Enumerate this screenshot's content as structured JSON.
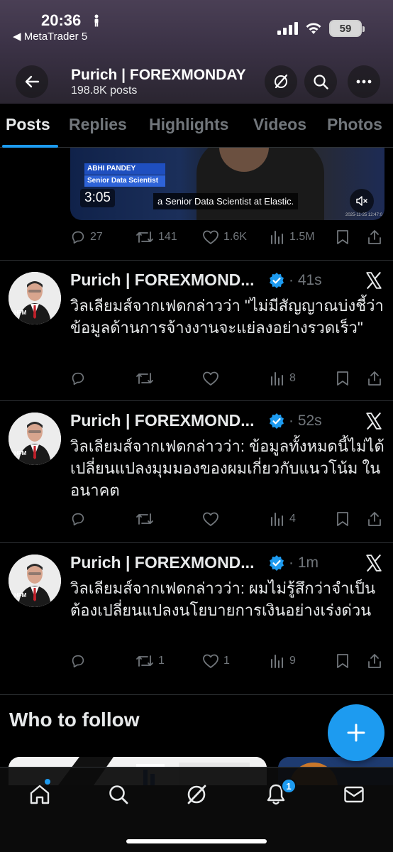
{
  "status_bar": {
    "time": "20:36",
    "back_app": "◀ MetaTrader 5",
    "battery": "59"
  },
  "profile": {
    "name": "Purich | FOREXMONDAY",
    "posts_count": "198.8K posts"
  },
  "tabs": [
    "Posts",
    "Replies",
    "Highlights",
    "Videos",
    "Photos"
  ],
  "video_card": {
    "person_name": "ABHI PANDEY",
    "person_title": "Senior Data Scientist",
    "duration": "3:05",
    "caption": "a Senior Data Scientist at Elastic.",
    "stamp": "2025-11-25 12:47:0"
  },
  "first_post_stats": {
    "replies": "27",
    "reposts": "141",
    "likes": "1.6K",
    "views": "1.5M"
  },
  "tweets": [
    {
      "name": "Purich | FOREXMOND...",
      "time": "· 41s",
      "text": "วิลเลียมส์จากเฟดกล่าวว่า \"ไม่มีสัญญาณบ่งชี้ว่าข้อมูลด้านการจ้างงานจะแย่ลงอย่างรวดเร็ว\"",
      "replies": "",
      "reposts": "",
      "likes": "",
      "views": "8"
    },
    {
      "name": "Purich | FOREXMOND...",
      "time": "· 52s",
      "text": "วิลเลียมส์จากเฟดกล่าวว่า: ข้อมูลทั้งหมดนี้ไม่ได้เปลี่ยนแปลงมุมมองของผมเกี่ยวกับแนวโน้ม ในอนาคต",
      "replies": "",
      "reposts": "",
      "likes": "",
      "views": "4"
    },
    {
      "name": "Purich | FOREXMOND...",
      "time": "· 1m",
      "text": "วิลเลียมส์จากเฟดกล่าวว่า: ผมไม่รู้สึกว่าจำเป็นต้องเปลี่ยนแปลงนโยบายการเงินอย่างเร่งด่วน",
      "replies": "",
      "reposts": "1",
      "likes": "1",
      "views": "9"
    }
  ],
  "who_to_follow": {
    "title": "Who to follow"
  },
  "notifications_badge": "1",
  "colors": {
    "accent": "#1d9bf0",
    "verified": "#1d9bf0",
    "muted": "#71767b",
    "text": "#e7e9ea",
    "divider": "#2f3336"
  },
  "icons": {
    "header": [
      "arrow-left-icon",
      "grok-icon",
      "search-icon",
      "more-icon"
    ],
    "actions": [
      "reply-icon",
      "repost-icon",
      "like-icon",
      "views-icon",
      "bookmark-icon",
      "share-icon"
    ],
    "nav": [
      "home-icon",
      "search-icon",
      "grok-icon",
      "bell-icon",
      "mail-icon"
    ]
  }
}
